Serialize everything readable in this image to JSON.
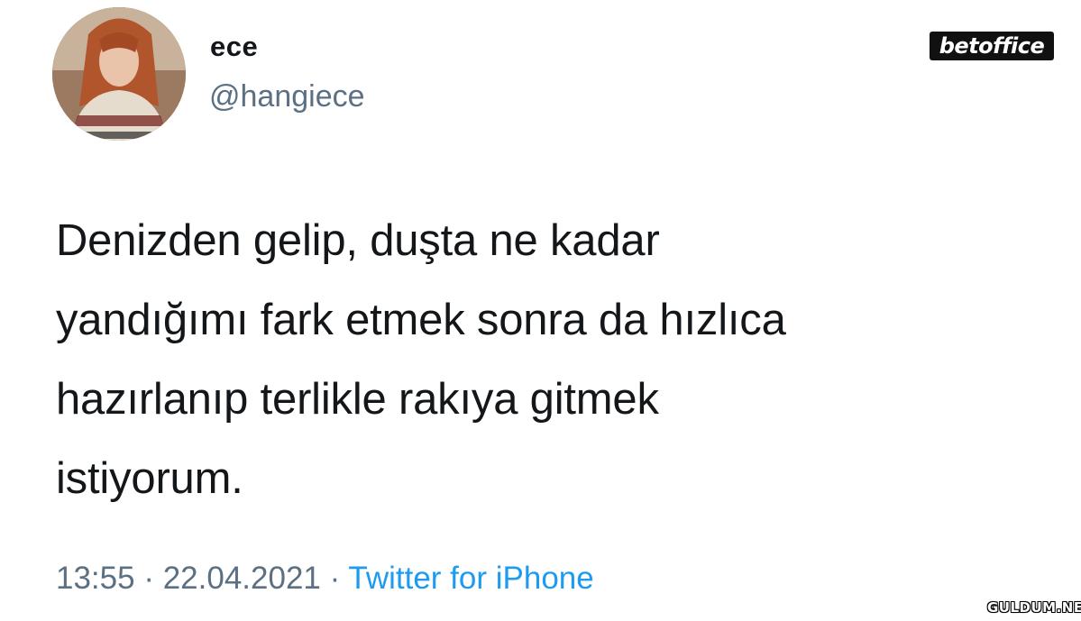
{
  "user": {
    "display_name": "ece",
    "handle": "@hangiece"
  },
  "tweet": {
    "text": "Denizden gelip, duşta ne kadar\nyandığımı fark etmek sonra da hızlıca\nhazırlanıp terlikle rakıya gitmek\nistiyorum.",
    "time": "13:55",
    "separator": "·",
    "date": "22.04.2021",
    "source": "Twitter for iPhone"
  },
  "watermarks": {
    "top_right": "betoffice",
    "bottom_right": "GULDUM.NET"
  },
  "colors": {
    "text": "#14171a",
    "secondary": "#5b7083",
    "link": "#1d9bf0"
  }
}
